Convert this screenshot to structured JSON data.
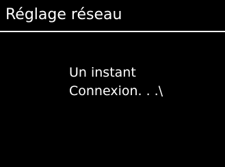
{
  "header": {
    "title": "Réglage réseau"
  },
  "main": {
    "message_lines": [
      "Un instant",
      "Connexion. . .\\"
    ]
  },
  "colors": {
    "background": "#000000",
    "text": "#ffffff",
    "rule": "#ffffff"
  }
}
